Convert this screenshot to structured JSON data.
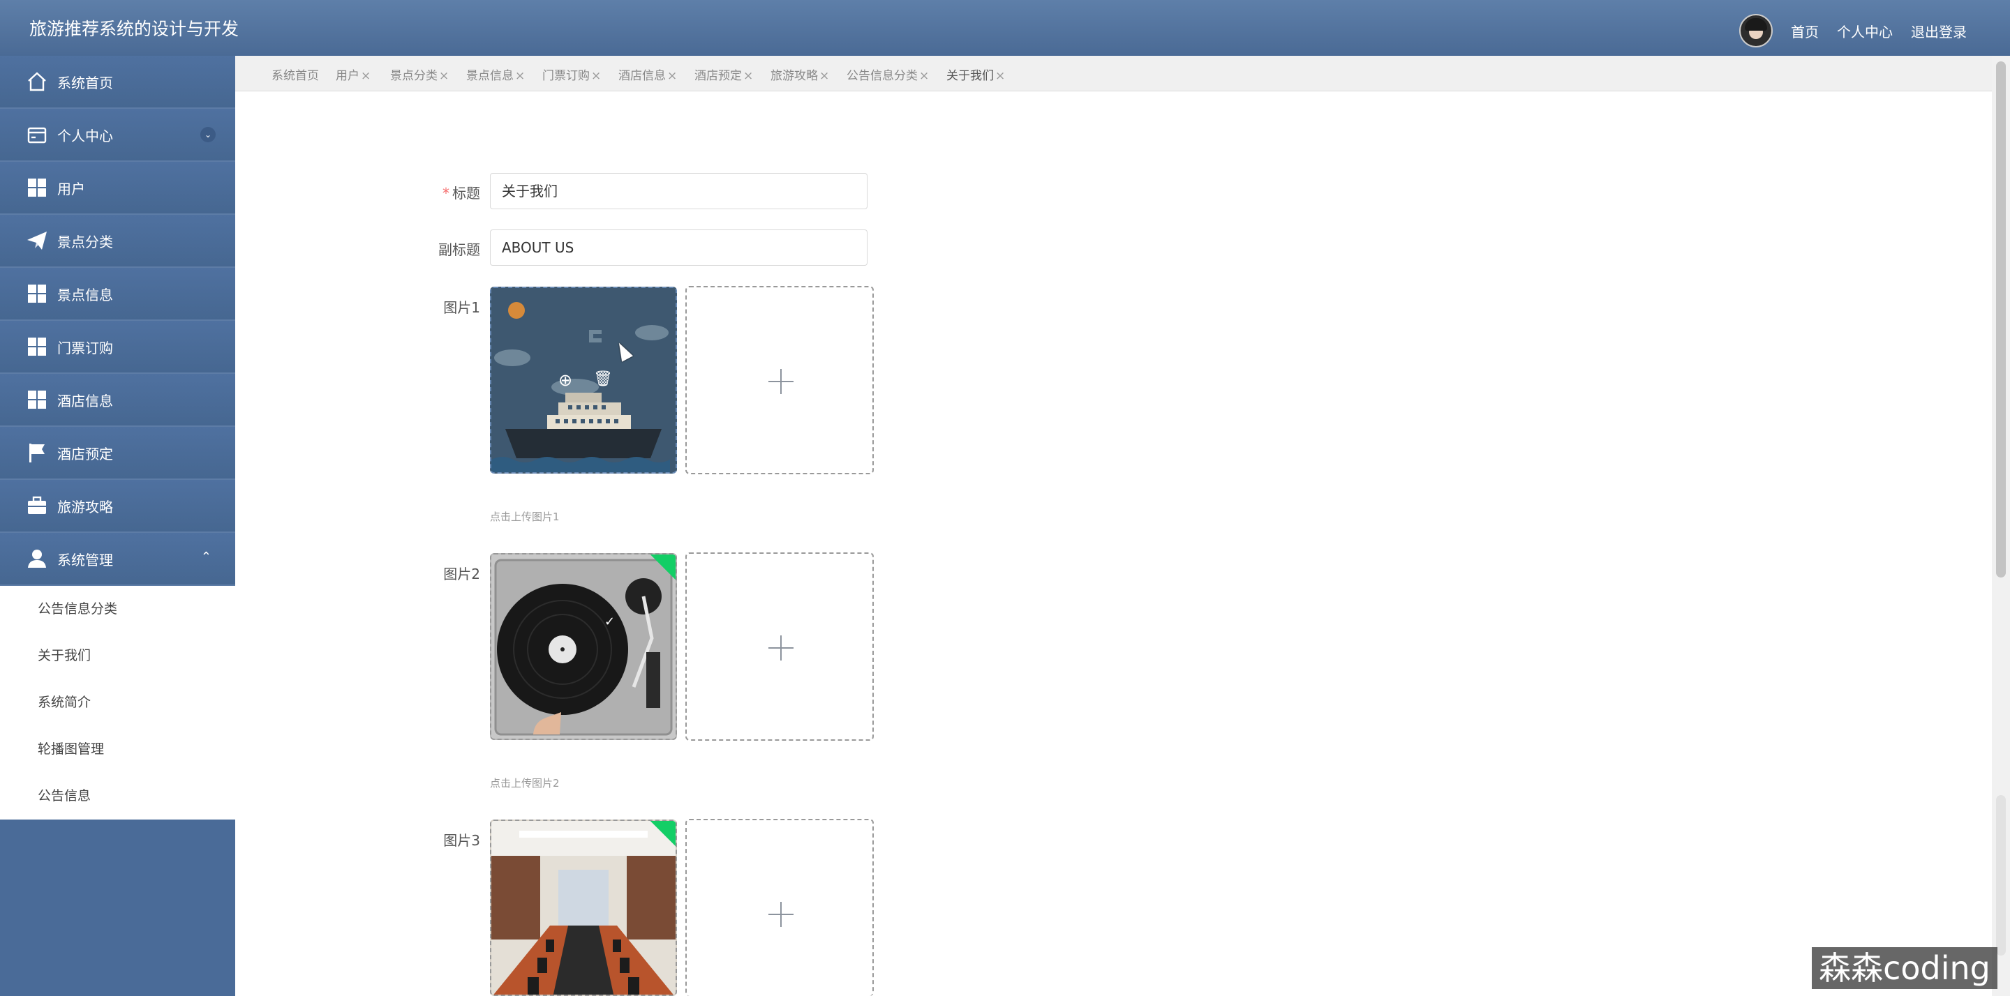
{
  "header": {
    "title": "旅游推荐系统的设计与开发",
    "links": [
      "首页",
      "个人中心",
      "退出登录"
    ]
  },
  "sidebar": {
    "items": [
      {
        "label": "系统首页",
        "icon": "home-icon"
      },
      {
        "label": "个人中心",
        "icon": "wallet-icon",
        "expandable": true
      },
      {
        "label": "用户",
        "icon": "grid-icon"
      },
      {
        "label": "景点分类",
        "icon": "paper-plane-icon"
      },
      {
        "label": "景点信息",
        "icon": "grid-icon"
      },
      {
        "label": "门票订购",
        "icon": "grid-icon"
      },
      {
        "label": "酒店信息",
        "icon": "grid-icon"
      },
      {
        "label": "酒店预定",
        "icon": "flag-icon"
      },
      {
        "label": "旅游攻略",
        "icon": "briefcase-icon"
      },
      {
        "label": "系统管理",
        "icon": "user-icon",
        "expanded": true
      }
    ],
    "submenu": [
      "公告信息分类",
      "关于我们",
      "系统简介",
      "轮播图管理",
      "公告信息"
    ]
  },
  "tabs": [
    {
      "label": "系统首页",
      "closable": false
    },
    {
      "label": "用户",
      "closable": true
    },
    {
      "label": "景点分类",
      "closable": true
    },
    {
      "label": "景点信息",
      "closable": true
    },
    {
      "label": "门票订购",
      "closable": true
    },
    {
      "label": "酒店信息",
      "closable": true
    },
    {
      "label": "酒店预定",
      "closable": true
    },
    {
      "label": "旅游攻略",
      "closable": true
    },
    {
      "label": "公告信息分类",
      "closable": true
    },
    {
      "label": "关于我们",
      "closable": true,
      "active": true
    }
  ],
  "form": {
    "title_label": "标题",
    "title_value": "关于我们",
    "subtitle_label": "副标题",
    "subtitle_value": "ABOUT US",
    "pic1_label": "图片1",
    "pic1_tip": "点击上传图片1",
    "pic2_label": "图片2",
    "pic2_tip": "点击上传图片2",
    "pic3_label": "图片3"
  },
  "watermark": "森森coding",
  "colors": {
    "sidebar": "#4a6b98",
    "header": "#5575a0",
    "success_badge": "#13ce66"
  }
}
